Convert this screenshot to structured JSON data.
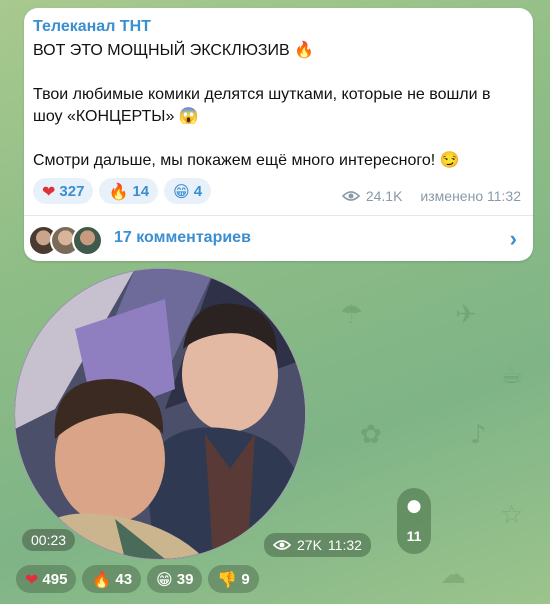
{
  "post": {
    "channel_name": "Телеканал ТНТ",
    "line1": "ВОТ ЭТО МОЩНЫЙ ЭКСКЛЮЗИВ 🔥",
    "line2": "Твои любимые комики делятся шутками, которые не вошли в шоу «КОНЦЕРТЫ» 😱",
    "line3": "Смотри дальше, мы покажем ещё много интересного! 😏",
    "reactions": [
      {
        "emoji": "❤",
        "count": "327"
      },
      {
        "emoji": "🔥",
        "count": "14"
      },
      {
        "emoji": "😁",
        "count": "4"
      }
    ],
    "views": "24.1K",
    "edited_time": "изменено 11:32",
    "comments_label": "17 комментариев"
  },
  "video_message": {
    "duration": "00:23",
    "views": "27K",
    "time": "11:32",
    "comments_count": "11",
    "reactions": [
      {
        "emoji": "❤",
        "count": "495"
      },
      {
        "emoji": "🔥",
        "count": "43"
      },
      {
        "emoji": "😁",
        "count": "39"
      },
      {
        "emoji": "👎",
        "count": "9"
      }
    ]
  },
  "colors": {
    "accent": "#3a8fd0",
    "bubble": "#ffffff",
    "wallpaper": "#8fbd86"
  }
}
